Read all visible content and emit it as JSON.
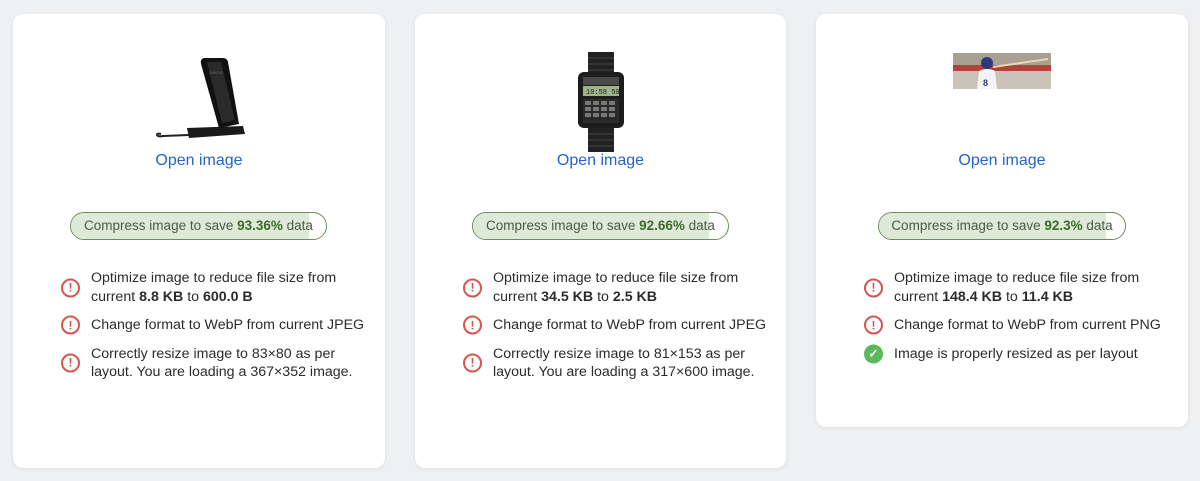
{
  "cards": [
    {
      "open_label": "Open image",
      "savings": {
        "prefix": "Compress image to save ",
        "value": "93.36%",
        "suffix": " data",
        "fraction": 0.9336
      },
      "checks": [
        {
          "status": "warn",
          "parts": [
            "Optimize image to reduce file size from current ",
            "8.8 KB",
            " to ",
            "600.0 B",
            ""
          ]
        },
        {
          "status": "warn",
          "parts": [
            "Change format to WebP from current JPEG"
          ]
        },
        {
          "status": "warn",
          "parts": [
            "Correctly resize image to 83×80 as per layout. You are loading a 367×352 image."
          ]
        }
      ],
      "thumbnail": "wireless-charger-stand"
    },
    {
      "open_label": "Open image",
      "savings": {
        "prefix": "Compress image to save ",
        "value": "92.66%",
        "suffix": " data",
        "fraction": 0.9266
      },
      "checks": [
        {
          "status": "warn",
          "parts": [
            "Optimize image to reduce file size from current ",
            "34.5 KB",
            " to ",
            "2.5 KB",
            ""
          ]
        },
        {
          "status": "warn",
          "parts": [
            "Change format to WebP from current JPEG"
          ]
        },
        {
          "status": "warn",
          "parts": [
            "Correctly resize image to 81×153 as per layout. You are loading a 317×600 image."
          ]
        }
      ],
      "thumbnail": "calculator-watch"
    },
    {
      "open_label": "Open image",
      "savings": {
        "prefix": "Compress image to save ",
        "value": "92.3%",
        "suffix": " data",
        "fraction": 0.923
      },
      "checks": [
        {
          "status": "warn",
          "parts": [
            "Optimize image to reduce file size from current ",
            "148.4 KB",
            " to ",
            "11.4 KB",
            ""
          ]
        },
        {
          "status": "warn",
          "parts": [
            "Change format to WebP from current PNG"
          ]
        },
        {
          "status": "ok",
          "parts": [
            "Image is properly resized as per layout"
          ]
        }
      ],
      "thumbnail": "baseball-player-photo"
    }
  ],
  "colors": {
    "link": "#2463c9",
    "warn": "#d9534f",
    "ok": "#5cb85c",
    "pill_border": "#6f8a63",
    "pill_fill": "#dfe9d8"
  },
  "icons": {
    "warn": "exclamation-circle-icon",
    "ok": "check-circle-icon"
  }
}
